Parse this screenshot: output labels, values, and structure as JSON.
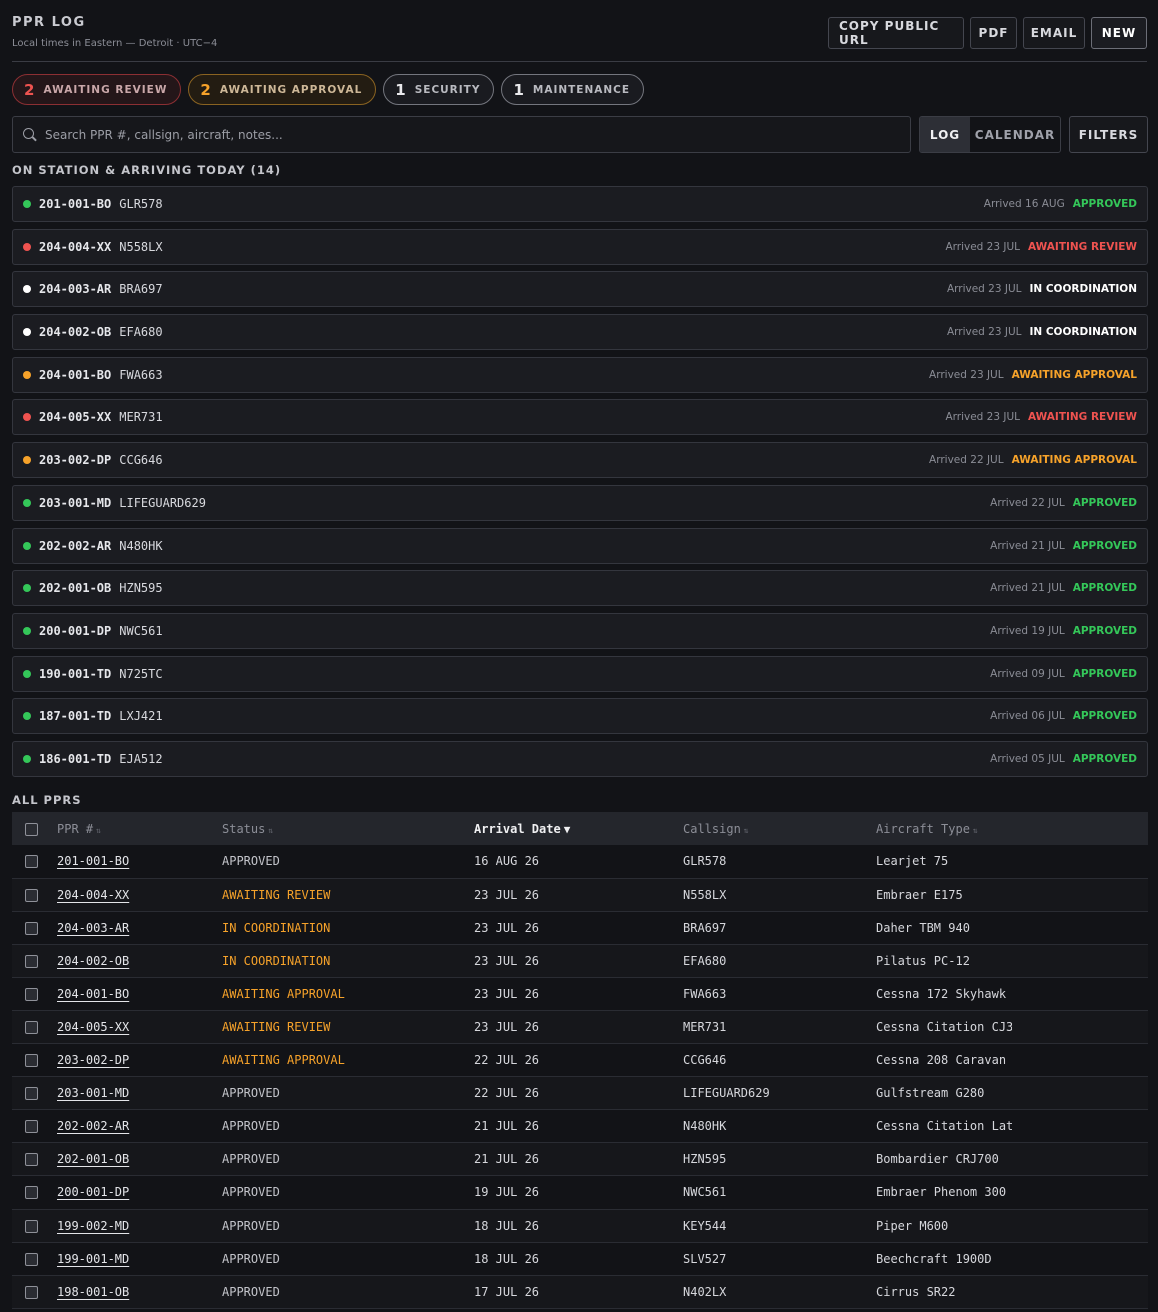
{
  "header": {
    "title": "PPR LOG",
    "subtitle": "Local times in Eastern — Detroit · UTC−4",
    "buttons": {
      "copy_url": "COPY PUBLIC URL",
      "pdf": "PDF",
      "email": "EMAIL",
      "new": "NEW"
    }
  },
  "chips": [
    {
      "count": "2",
      "label": "AWAITING REVIEW",
      "tone": "red"
    },
    {
      "count": "2",
      "label": "AWAITING APPROVAL",
      "tone": "orange"
    },
    {
      "count": "1",
      "label": "SECURITY",
      "tone": "gray"
    },
    {
      "count": "1",
      "label": "MAINTENANCE",
      "tone": "gray"
    }
  ],
  "search": {
    "placeholder": "Search PPR #, callsign, aircraft, notes...",
    "value": ""
  },
  "view": {
    "log": "LOG",
    "calendar": "CALENDAR",
    "filters": "FILTERS",
    "active": "LOG"
  },
  "status_colors": {
    "APPROVED": "#34c759",
    "AWAITING REVIEW": "#ef5350",
    "IN COORDINATION": "#ffffff",
    "AWAITING APPROVAL": "#f6a22a"
  },
  "table_status_colors": {
    "APPROVED": "#c3c4ca",
    "AWAITING REVIEW": "#f6a22a",
    "IN COORDINATION": "#f6a22a",
    "AWAITING APPROVAL": "#f6a22a"
  },
  "station": {
    "title": "ON STATION & ARRIVING TODAY (14)",
    "rows": [
      {
        "ppr": "201-001-BO",
        "callsign": "GLR578",
        "arrived": "Arrived 16 AUG",
        "status": "APPROVED"
      },
      {
        "ppr": "204-004-XX",
        "callsign": "N558LX",
        "arrived": "Arrived 23 JUL",
        "status": "AWAITING REVIEW"
      },
      {
        "ppr": "204-003-AR",
        "callsign": "BRA697",
        "arrived": "Arrived 23 JUL",
        "status": "IN COORDINATION"
      },
      {
        "ppr": "204-002-OB",
        "callsign": "EFA680",
        "arrived": "Arrived 23 JUL",
        "status": "IN COORDINATION"
      },
      {
        "ppr": "204-001-BO",
        "callsign": "FWA663",
        "arrived": "Arrived 23 JUL",
        "status": "AWAITING APPROVAL"
      },
      {
        "ppr": "204-005-XX",
        "callsign": "MER731",
        "arrived": "Arrived 23 JUL",
        "status": "AWAITING REVIEW"
      },
      {
        "ppr": "203-002-DP",
        "callsign": "CCG646",
        "arrived": "Arrived 22 JUL",
        "status": "AWAITING APPROVAL"
      },
      {
        "ppr": "203-001-MD",
        "callsign": "LIFEGUARD629",
        "arrived": "Arrived 22 JUL",
        "status": "APPROVED"
      },
      {
        "ppr": "202-002-AR",
        "callsign": "N480HK",
        "arrived": "Arrived 21 JUL",
        "status": "APPROVED"
      },
      {
        "ppr": "202-001-OB",
        "callsign": "HZN595",
        "arrived": "Arrived 21 JUL",
        "status": "APPROVED"
      },
      {
        "ppr": "200-001-DP",
        "callsign": "NWC561",
        "arrived": "Arrived 19 JUL",
        "status": "APPROVED"
      },
      {
        "ppr": "190-001-TD",
        "callsign": "N725TC",
        "arrived": "Arrived 09 JUL",
        "status": "APPROVED"
      },
      {
        "ppr": "187-001-TD",
        "callsign": "LXJ421",
        "arrived": "Arrived 06 JUL",
        "status": "APPROVED"
      },
      {
        "ppr": "186-001-TD",
        "callsign": "EJA512",
        "arrived": "Arrived 05 JUL",
        "status": "APPROVED"
      }
    ]
  },
  "all": {
    "title": "ALL PPRS",
    "columns": [
      {
        "key": "ppr",
        "label": "PPR #",
        "sort": "⇅"
      },
      {
        "key": "status",
        "label": "Status",
        "sort": "⇅"
      },
      {
        "key": "arrival",
        "label": "Arrival Date",
        "sort": "▼",
        "sorted": true
      },
      {
        "key": "callsign",
        "label": "Callsign",
        "sort": "⇅"
      },
      {
        "key": "aircraft",
        "label": "Aircraft Type",
        "sort": "⇅"
      }
    ],
    "rows": [
      {
        "ppr": "201-001-BO",
        "status": "APPROVED",
        "arrival": "16 AUG 26",
        "callsign": "GLR578",
        "aircraft": "Learjet 75"
      },
      {
        "ppr": "204-004-XX",
        "status": "AWAITING REVIEW",
        "arrival": "23 JUL 26",
        "callsign": "N558LX",
        "aircraft": "Embraer E175"
      },
      {
        "ppr": "204-003-AR",
        "status": "IN COORDINATION",
        "arrival": "23 JUL 26",
        "callsign": "BRA697",
        "aircraft": "Daher TBM 940"
      },
      {
        "ppr": "204-002-OB",
        "status": "IN COORDINATION",
        "arrival": "23 JUL 26",
        "callsign": "EFA680",
        "aircraft": "Pilatus PC-12"
      },
      {
        "ppr": "204-001-BO",
        "status": "AWAITING APPROVAL",
        "arrival": "23 JUL 26",
        "callsign": "FWA663",
        "aircraft": "Cessna 172 Skyhawk"
      },
      {
        "ppr": "204-005-XX",
        "status": "AWAITING REVIEW",
        "arrival": "23 JUL 26",
        "callsign": "MER731",
        "aircraft": "Cessna Citation CJ3"
      },
      {
        "ppr": "203-002-DP",
        "status": "AWAITING APPROVAL",
        "arrival": "22 JUL 26",
        "callsign": "CCG646",
        "aircraft": "Cessna 208 Caravan"
      },
      {
        "ppr": "203-001-MD",
        "status": "APPROVED",
        "arrival": "22 JUL 26",
        "callsign": "LIFEGUARD629",
        "aircraft": "Gulfstream G280"
      },
      {
        "ppr": "202-002-AR",
        "status": "APPROVED",
        "arrival": "21 JUL 26",
        "callsign": "N480HK",
        "aircraft": "Cessna Citation Latitude"
      },
      {
        "ppr": "202-001-OB",
        "status": "APPROVED",
        "arrival": "21 JUL 26",
        "callsign": "HZN595",
        "aircraft": "Bombardier CRJ700"
      },
      {
        "ppr": "200-001-DP",
        "status": "APPROVED",
        "arrival": "19 JUL 26",
        "callsign": "NWC561",
        "aircraft": "Embraer Phenom 300"
      },
      {
        "ppr": "199-002-MD",
        "status": "APPROVED",
        "arrival": "18 JUL 26",
        "callsign": "KEY544",
        "aircraft": "Piper M600"
      },
      {
        "ppr": "199-001-MD",
        "status": "APPROVED",
        "arrival": "18 JUL 26",
        "callsign": "SLV527",
        "aircraft": "Beechcraft 1900D"
      },
      {
        "ppr": "198-001-OB",
        "status": "APPROVED",
        "arrival": "17 JUL 26",
        "callsign": "N402LX",
        "aircraft": "Cirrus SR22"
      }
    ]
  }
}
